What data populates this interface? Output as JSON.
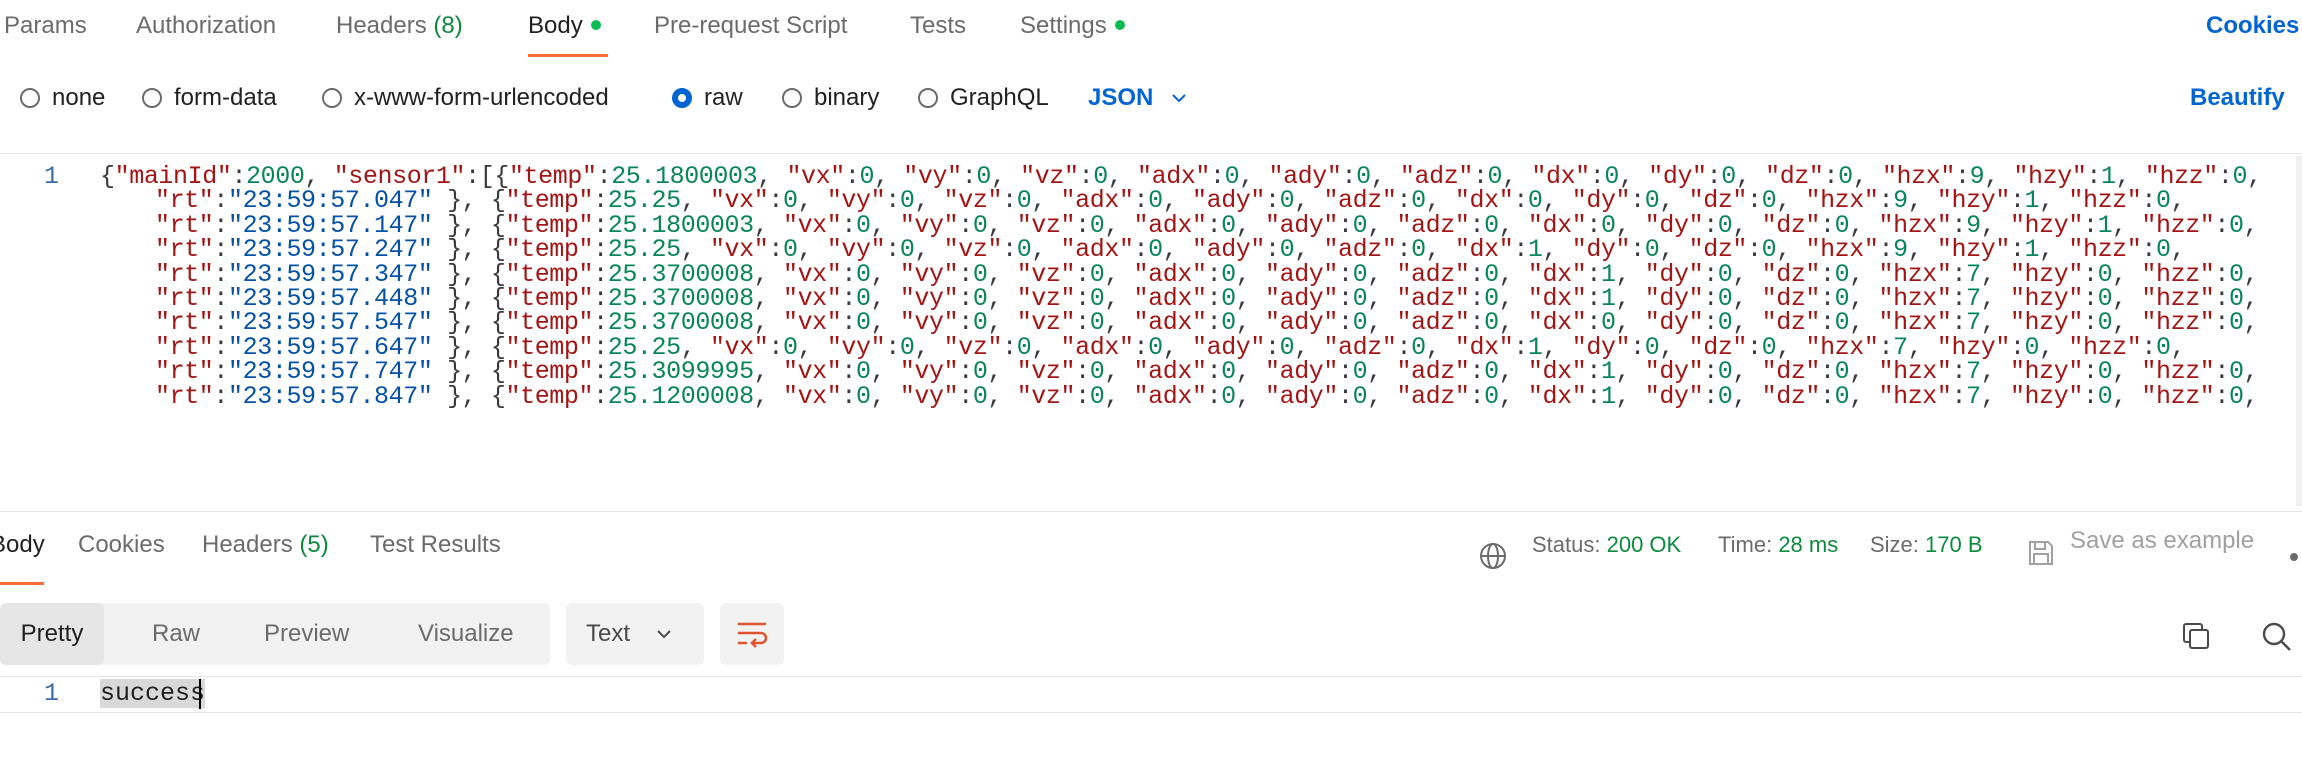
{
  "request_tabs": {
    "params": "Params",
    "authorization": "Authorization",
    "headers": "Headers",
    "headers_count": "(8)",
    "body": "Body",
    "prerequest": "Pre-request Script",
    "tests": "Tests",
    "settings": "Settings",
    "cookies": "Cookies"
  },
  "body_types": {
    "none": "none",
    "form_data": "form-data",
    "urlencoded": "x-www-form-urlencoded",
    "raw": "raw",
    "binary": "binary",
    "graphql": "GraphQL",
    "format": "JSON",
    "beautify": "Beautify"
  },
  "editor": {
    "line_number": "1",
    "first_line_prefix": "{\"mainId\":2000, \"sensor1\":[",
    "entries": [
      {
        "temp": "25.1800003",
        "vx": "0",
        "vy": "0",
        "vz": "0",
        "adx": "0",
        "ady": "0",
        "adz": "0",
        "dx": "0",
        "dy": "0",
        "dz": "0",
        "hzx": "9",
        "hzy": "1",
        "hzz": "0",
        "rt": "23:59:57.047"
      },
      {
        "temp": "25.25",
        "vx": "0",
        "vy": "0",
        "vz": "0",
        "adx": "0",
        "ady": "0",
        "adz": "0",
        "dx": "0",
        "dy": "0",
        "dz": "0",
        "hzx": "9",
        "hzy": "1",
        "hzz": "0",
        "rt": "23:59:57.147"
      },
      {
        "temp": "25.1800003",
        "vx": "0",
        "vy": "0",
        "vz": "0",
        "adx": "0",
        "ady": "0",
        "adz": "0",
        "dx": "0",
        "dy": "0",
        "dz": "0",
        "hzx": "9",
        "hzy": "1",
        "hzz": "0",
        "rt": "23:59:57.247"
      },
      {
        "temp": "25.25",
        "vx": "0",
        "vy": "0",
        "vz": "0",
        "adx": "0",
        "ady": "0",
        "adz": "0",
        "dx": "1",
        "dy": "0",
        "dz": "0",
        "hzx": "9",
        "hzy": "1",
        "hzz": "0",
        "rt": "23:59:57.347"
      },
      {
        "temp": "25.3700008",
        "vx": "0",
        "vy": "0",
        "vz": "0",
        "adx": "0",
        "ady": "0",
        "adz": "0",
        "dx": "1",
        "dy": "0",
        "dz": "0",
        "hzx": "7",
        "hzy": "0",
        "hzz": "0",
        "rt": "23:59:57.448"
      },
      {
        "temp": "25.3700008",
        "vx": "0",
        "vy": "0",
        "vz": "0",
        "adx": "0",
        "ady": "0",
        "adz": "0",
        "dx": "1",
        "dy": "0",
        "dz": "0",
        "hzx": "7",
        "hzy": "0",
        "hzz": "0",
        "rt": "23:59:57.547"
      },
      {
        "temp": "25.3700008",
        "vx": "0",
        "vy": "0",
        "vz": "0",
        "adx": "0",
        "ady": "0",
        "adz": "0",
        "dx": "0",
        "dy": "0",
        "dz": "0",
        "hzx": "7",
        "hzy": "0",
        "hzz": "0",
        "rt": "23:59:57.647"
      },
      {
        "temp": "25.25",
        "vx": "0",
        "vy": "0",
        "vz": "0",
        "adx": "0",
        "ady": "0",
        "adz": "0",
        "dx": "1",
        "dy": "0",
        "dz": "0",
        "hzx": "7",
        "hzy": "0",
        "hzz": "0",
        "rt": "23:59:57.747"
      },
      {
        "temp": "25.3099995",
        "vx": "0",
        "vy": "0",
        "vz": "0",
        "adx": "0",
        "ady": "0",
        "adz": "0",
        "dx": "1",
        "dy": "0",
        "dz": "0",
        "hzx": "7",
        "hzy": "0",
        "hzz": "0",
        "rt": "23:59:57.847"
      },
      {
        "temp": "25.1200008",
        "vx": "0",
        "vy": "0",
        "vz": "0",
        "adx": "0",
        "ady": "0",
        "adz": "0",
        "dx": "1",
        "dy": "0",
        "dz": "0",
        "hzx": "7",
        "hzy": "0",
        "hzz": "0"
      }
    ]
  },
  "response": {
    "tabs": {
      "body": "Body",
      "cookies": "Cookies",
      "headers": "Headers",
      "headers_count": "(5)",
      "test_results": "Test Results"
    },
    "status_label": "Status:",
    "status_value": "200 OK",
    "time_label": "Time:",
    "time_value": "28 ms",
    "size_label": "Size:",
    "size_value": "170 B",
    "save_example": "Save as example",
    "views": {
      "pretty": "Pretty",
      "raw": "Raw",
      "preview": "Preview",
      "visualize": "Visualize"
    },
    "format": "Text",
    "line_number": "1",
    "body_text": "success"
  },
  "colors": {
    "accent": "#ff6c37",
    "link": "#0265d2",
    "ok": "#0b8a3e",
    "dot": "#0cbb52"
  }
}
